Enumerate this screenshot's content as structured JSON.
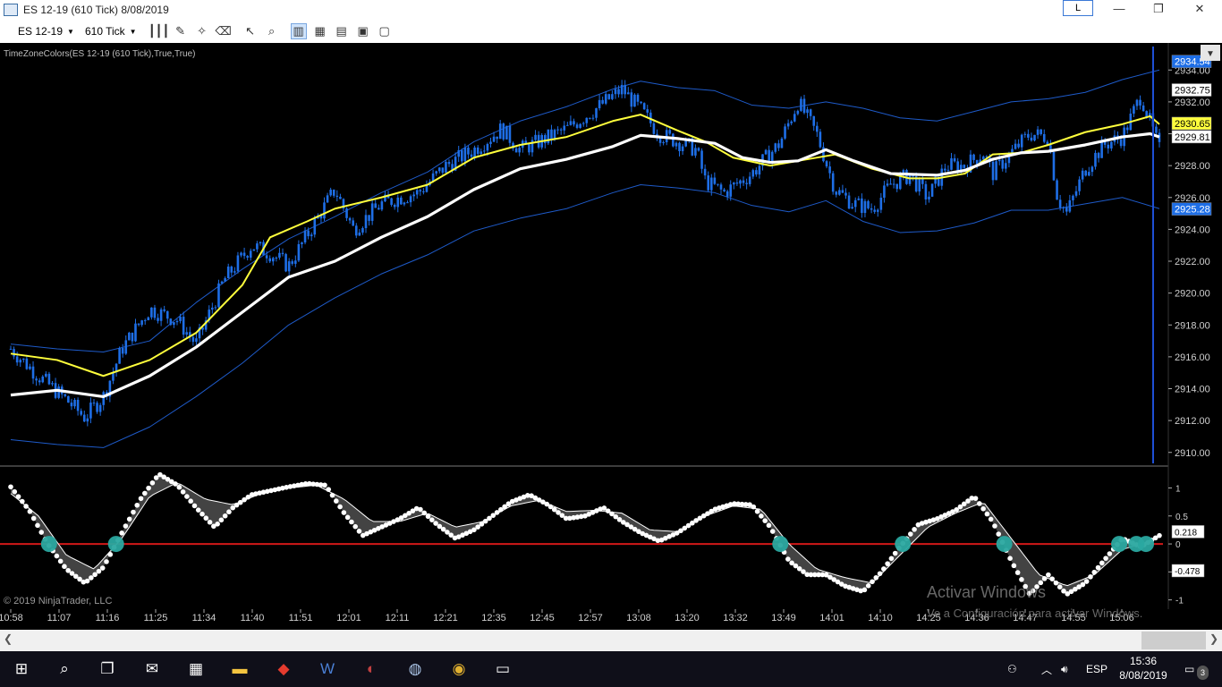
{
  "window": {
    "title": "ES 12-19 (610 Tick)  8/08/2019",
    "layout_button": "L",
    "minimize": "—",
    "maximize": "❐",
    "close": "✕"
  },
  "toolbar": {
    "instrument": "ES 12-19",
    "interval": "610 Tick"
  },
  "indicator_label": "TimeZoneColors(ES 12-19 (610 Tick),True,True)",
  "copyright": "© 2019 NinjaTrader, LLC",
  "watermark": {
    "line1": "Activar Windows",
    "line2": "Ve a Configuración para activar Windows."
  },
  "taskbar": {
    "lang": "ESP",
    "time": "15:36",
    "date": "8/08/2019",
    "notifications": "3"
  },
  "colors": {
    "candles": "#1e6ee6",
    "ema_yellow": "#ffff3c",
    "ema_white": "#ffffff",
    "bands": "#1e5ac8",
    "zero_line": "#d01818",
    "cross_marker": "#2aa8a0",
    "osc_fill": "#4a4a4a"
  },
  "chart_data": [
    {
      "type": "candlestick",
      "x_ticks": [
        "10:58",
        "11:07",
        "11:16",
        "11:25",
        "11:34",
        "11:40",
        "11:51",
        "12:01",
        "12:11",
        "12:21",
        "12:35",
        "12:45",
        "12:57",
        "13:08",
        "13:20",
        "13:32",
        "13:49",
        "14:01",
        "14:10",
        "14:25",
        "14:36",
        "14:47",
        "14:55",
        "15:06"
      ],
      "y_ticks": [
        "2910.00",
        "2912.00",
        "2914.00",
        "2916.00",
        "2918.00",
        "2920.00",
        "2922.00",
        "2924.00",
        "2926.00",
        "2928.00",
        "2930.00",
        "2932.00",
        "2934.00"
      ],
      "ylim": [
        2909.2,
        2935.7
      ],
      "price_labels": [
        {
          "text": "2934.54",
          "value": 2934.54,
          "bg": "#1e6ee6",
          "fg": "#ffffff"
        },
        {
          "text": "2932.75",
          "value": 2932.75,
          "bg": "#ffffff",
          "fg": "#000000"
        },
        {
          "text": "2930.65",
          "value": 2930.65,
          "bg": "#ffff3c",
          "fg": "#000000"
        },
        {
          "text": "2929.81",
          "value": 2929.81,
          "bg": "#ffffff",
          "fg": "#000000"
        },
        {
          "text": "2925.28",
          "value": 2925.28,
          "bg": "#1e6ee6",
          "fg": "#ffffff"
        }
      ],
      "close_path": [
        [
          0,
          2916.5
        ],
        [
          3,
          2914.8
        ],
        [
          6,
          2913.3
        ],
        [
          8,
          2912.2
        ],
        [
          10,
          2913.5
        ],
        [
          12,
          2916.5
        ],
        [
          15,
          2919.0
        ],
        [
          18,
          2918.3
        ],
        [
          20,
          2916.8
        ],
        [
          23,
          2920.8
        ],
        [
          26,
          2923.0
        ],
        [
          28,
          2922.5
        ],
        [
          30,
          2921.7
        ],
        [
          33,
          2924.6
        ],
        [
          35,
          2926.5
        ],
        [
          37,
          2924.0
        ],
        [
          40,
          2925.6
        ],
        [
          42,
          2926.0
        ],
        [
          44,
          2926.3
        ],
        [
          47,
          2928.0
        ],
        [
          50,
          2929.0
        ],
        [
          53,
          2930.3
        ],
        [
          55,
          2929.0
        ],
        [
          57,
          2929.5
        ],
        [
          60,
          2930.3
        ],
        [
          63,
          2931.5
        ],
        [
          66,
          2932.8
        ],
        [
          68,
          2931.5
        ],
        [
          70,
          2930.0
        ],
        [
          72,
          2929.5
        ],
        [
          74,
          2929.0
        ],
        [
          75,
          2927.0
        ],
        [
          77,
          2926.3
        ],
        [
          80,
          2927.5
        ],
        [
          83,
          2929.4
        ],
        [
          85,
          2932.0
        ],
        [
          87,
          2930.0
        ],
        [
          89,
          2926.5
        ],
        [
          91,
          2925.6
        ],
        [
          93,
          2925.3
        ],
        [
          95,
          2926.8
        ],
        [
          97,
          2927.4
        ],
        [
          99,
          2926.0
        ],
        [
          101,
          2928.0
        ],
        [
          103,
          2928.0
        ],
        [
          105,
          2928.8
        ],
        [
          106,
          2927.5
        ],
        [
          108,
          2928.8
        ],
        [
          110,
          2930.0
        ],
        [
          112,
          2929.8
        ],
        [
          113,
          2926.0
        ],
        [
          114,
          2925.0
        ],
        [
          116,
          2927.8
        ],
        [
          118,
          2929.3
        ],
        [
          120,
          2929.8
        ],
        [
          122,
          2932.4
        ],
        [
          124,
          2929.0
        ]
      ],
      "ema_yellow": [
        [
          0,
          2916.2
        ],
        [
          5,
          2915.8
        ],
        [
          10,
          2914.8
        ],
        [
          15,
          2915.8
        ],
        [
          20,
          2917.5
        ],
        [
          25,
          2920.5
        ],
        [
          28,
          2923.5
        ],
        [
          32,
          2924.5
        ],
        [
          35,
          2925.3
        ],
        [
          40,
          2926.0
        ],
        [
          45,
          2926.8
        ],
        [
          50,
          2928.5
        ],
        [
          55,
          2929.3
        ],
        [
          60,
          2929.8
        ],
        [
          65,
          2930.8
        ],
        [
          68,
          2931.2
        ],
        [
          72,
          2930.2
        ],
        [
          75,
          2929.5
        ],
        [
          78,
          2928.5
        ],
        [
          82,
          2928.0
        ],
        [
          85,
          2928.3
        ],
        [
          89,
          2928.7
        ],
        [
          93,
          2927.8
        ],
        [
          97,
          2927.2
        ],
        [
          100,
          2927.2
        ],
        [
          103,
          2927.5
        ],
        [
          106,
          2928.7
        ],
        [
          109,
          2928.8
        ],
        [
          112,
          2929.3
        ],
        [
          116,
          2930.1
        ],
        [
          120,
          2930.6
        ],
        [
          123,
          2931.1
        ],
        [
          124,
          2930.6
        ]
      ],
      "ema_white": [
        [
          0,
          2913.6
        ],
        [
          5,
          2913.9
        ],
        [
          10,
          2913.5
        ],
        [
          15,
          2914.8
        ],
        [
          20,
          2916.6
        ],
        [
          25,
          2918.8
        ],
        [
          30,
          2921.0
        ],
        [
          35,
          2922.0
        ],
        [
          40,
          2923.5
        ],
        [
          45,
          2924.8
        ],
        [
          50,
          2926.5
        ],
        [
          55,
          2927.8
        ],
        [
          60,
          2928.4
        ],
        [
          65,
          2929.2
        ],
        [
          68,
          2929.9
        ],
        [
          72,
          2929.7
        ],
        [
          76,
          2929.4
        ],
        [
          79,
          2928.5
        ],
        [
          82,
          2928.2
        ],
        [
          85,
          2928.3
        ],
        [
          88,
          2929.0
        ],
        [
          91,
          2928.3
        ],
        [
          95,
          2927.5
        ],
        [
          100,
          2927.4
        ],
        [
          103,
          2927.7
        ],
        [
          106,
          2928.4
        ],
        [
          109,
          2928.8
        ],
        [
          112,
          2928.9
        ],
        [
          116,
          2929.3
        ],
        [
          120,
          2929.8
        ],
        [
          123,
          2930.0
        ],
        [
          124,
          2929.8
        ]
      ],
      "band_upper": [
        [
          0,
          2916.8
        ],
        [
          5,
          2916.5
        ],
        [
          10,
          2916.3
        ],
        [
          15,
          2917.0
        ],
        [
          20,
          2919.4
        ],
        [
          25,
          2921.5
        ],
        [
          30,
          2923.4
        ],
        [
          35,
          2924.8
        ],
        [
          40,
          2926.3
        ],
        [
          45,
          2927.6
        ],
        [
          50,
          2929.5
        ],
        [
          55,
          2930.8
        ],
        [
          60,
          2931.7
        ],
        [
          65,
          2932.8
        ],
        [
          68,
          2933.3
        ],
        [
          72,
          2932.9
        ],
        [
          76,
          2932.7
        ],
        [
          80,
          2931.8
        ],
        [
          84,
          2931.6
        ],
        [
          88,
          2932.0
        ],
        [
          92,
          2931.6
        ],
        [
          96,
          2931.0
        ],
        [
          100,
          2930.8
        ],
        [
          104,
          2931.4
        ],
        [
          108,
          2932.0
        ],
        [
          112,
          2932.2
        ],
        [
          116,
          2932.6
        ],
        [
          120,
          2933.4
        ],
        [
          124,
          2934.0
        ]
      ],
      "band_lower": [
        [
          0,
          2910.8
        ],
        [
          5,
          2910.5
        ],
        [
          10,
          2910.3
        ],
        [
          15,
          2911.6
        ],
        [
          20,
          2913.5
        ],
        [
          25,
          2915.6
        ],
        [
          30,
          2918.0
        ],
        [
          35,
          2919.7
        ],
        [
          40,
          2921.2
        ],
        [
          45,
          2922.4
        ],
        [
          50,
          2923.9
        ],
        [
          55,
          2924.7
        ],
        [
          60,
          2925.3
        ],
        [
          65,
          2926.3
        ],
        [
          68,
          2926.8
        ],
        [
          72,
          2926.6
        ],
        [
          76,
          2926.3
        ],
        [
          80,
          2925.5
        ],
        [
          84,
          2925.1
        ],
        [
          88,
          2925.8
        ],
        [
          92,
          2924.5
        ],
        [
          96,
          2923.8
        ],
        [
          100,
          2923.9
        ],
        [
          104,
          2924.4
        ],
        [
          108,
          2925.2
        ],
        [
          112,
          2925.2
        ],
        [
          116,
          2925.6
        ],
        [
          120,
          2926.0
        ],
        [
          124,
          2925.3
        ]
      ]
    },
    {
      "type": "line",
      "y_ticks": [
        "1",
        "0.5",
        "0",
        "-0.5",
        "-1"
      ],
      "ylim": [
        -1.15,
        1.28
      ],
      "value_labels": [
        {
          "text": "0.218",
          "value": 0.218
        },
        {
          "text": "-0.478",
          "value": -0.478
        }
      ],
      "fast": [
        [
          0,
          1.02
        ],
        [
          2,
          0.6
        ],
        [
          4,
          0.0
        ],
        [
          6,
          -0.45
        ],
        [
          8,
          -0.7
        ],
        [
          10,
          -0.42
        ],
        [
          12,
          0.2
        ],
        [
          14,
          0.8
        ],
        [
          16,
          1.25
        ],
        [
          18,
          1.05
        ],
        [
          20,
          0.65
        ],
        [
          22,
          0.3
        ],
        [
          24,
          0.65
        ],
        [
          26,
          0.88
        ],
        [
          28,
          0.95
        ],
        [
          30,
          1.02
        ],
        [
          32,
          1.08
        ],
        [
          34,
          1.05
        ],
        [
          36,
          0.55
        ],
        [
          38,
          0.15
        ],
        [
          40,
          0.3
        ],
        [
          42,
          0.45
        ],
        [
          44,
          0.65
        ],
        [
          46,
          0.35
        ],
        [
          48,
          0.1
        ],
        [
          50,
          0.25
        ],
        [
          52,
          0.5
        ],
        [
          54,
          0.75
        ],
        [
          56,
          0.88
        ],
        [
          58,
          0.7
        ],
        [
          60,
          0.45
        ],
        [
          62,
          0.5
        ],
        [
          64,
          0.65
        ],
        [
          66,
          0.4
        ],
        [
          68,
          0.2
        ],
        [
          70,
          0.05
        ],
        [
          72,
          0.2
        ],
        [
          74,
          0.42
        ],
        [
          76,
          0.62
        ],
        [
          78,
          0.72
        ],
        [
          80,
          0.7
        ],
        [
          82,
          0.3
        ],
        [
          84,
          -0.3
        ],
        [
          86,
          -0.55
        ],
        [
          88,
          -0.55
        ],
        [
          90,
          -0.75
        ],
        [
          92,
          -0.85
        ],
        [
          94,
          -0.5
        ],
        [
          96,
          -0.05
        ],
        [
          98,
          0.35
        ],
        [
          100,
          0.45
        ],
        [
          102,
          0.6
        ],
        [
          104,
          0.85
        ],
        [
          106,
          0.4
        ],
        [
          108,
          -0.3
        ],
        [
          110,
          -0.9
        ],
        [
          112,
          -0.55
        ],
        [
          114,
          -0.9
        ],
        [
          116,
          -0.7
        ],
        [
          118,
          -0.3
        ],
        [
          120,
          0.1
        ],
        [
          122,
          -0.05
        ],
        [
          124,
          0.15
        ]
      ],
      "slow": [
        [
          0,
          0.9
        ],
        [
          3,
          0.5
        ],
        [
          6,
          -0.2
        ],
        [
          9,
          -0.45
        ],
        [
          12,
          0.1
        ],
        [
          15,
          0.85
        ],
        [
          18,
          1.1
        ],
        [
          21,
          0.8
        ],
        [
          24,
          0.7
        ],
        [
          27,
          0.9
        ],
        [
          30,
          1.0
        ],
        [
          33,
          1.05
        ],
        [
          36,
          0.8
        ],
        [
          39,
          0.4
        ],
        [
          42,
          0.4
        ],
        [
          45,
          0.55
        ],
        [
          48,
          0.3
        ],
        [
          51,
          0.4
        ],
        [
          54,
          0.68
        ],
        [
          57,
          0.78
        ],
        [
          60,
          0.58
        ],
        [
          63,
          0.6
        ],
        [
          66,
          0.55
        ],
        [
          69,
          0.25
        ],
        [
          72,
          0.22
        ],
        [
          75,
          0.5
        ],
        [
          78,
          0.68
        ],
        [
          81,
          0.62
        ],
        [
          84,
          0.0
        ],
        [
          87,
          -0.45
        ],
        [
          90,
          -0.6
        ],
        [
          93,
          -0.7
        ],
        [
          96,
          -0.2
        ],
        [
          99,
          0.3
        ],
        [
          102,
          0.55
        ],
        [
          105,
          0.75
        ],
        [
          108,
          0.1
        ],
        [
          111,
          -0.55
        ],
        [
          114,
          -0.75
        ],
        [
          117,
          -0.55
        ],
        [
          120,
          -0.1
        ],
        [
          123,
          0.05
        ],
        [
          124,
          0.15
        ]
      ]
    }
  ]
}
